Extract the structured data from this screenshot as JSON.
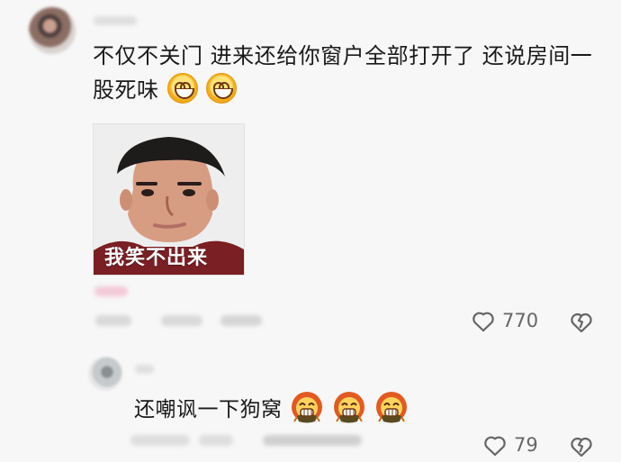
{
  "comment": {
    "text": "不仅不关门 进来还给你窗户全部打开了 还说房间一股死味",
    "inline_emoji_name": "grinning-face-emoji",
    "sticker_caption": "我笑不出来",
    "likes": "770"
  },
  "reply": {
    "text": "还嘲讽一下狗窝",
    "inline_emoji_name": "grinning-cool-emoji",
    "likes": "79"
  },
  "icons": {
    "like": "heart-icon",
    "dislike": "broken-heart-icon"
  },
  "colors": {
    "background": "#f7f7f7",
    "text": "#1a1a1a",
    "meta": "#666666"
  }
}
